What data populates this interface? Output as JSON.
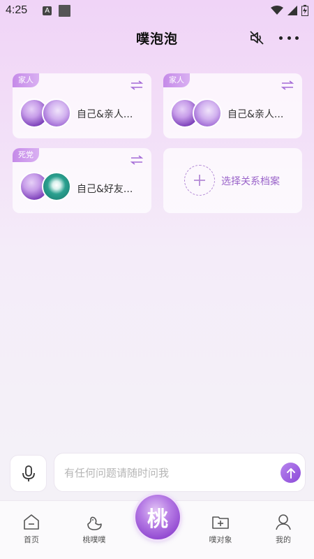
{
  "status_bar": {
    "time": "4:25",
    "a_badge": "A"
  },
  "header": {
    "title": "噗泡泡"
  },
  "cards": [
    {
      "tag": "家人",
      "label": "自己&亲人..."
    },
    {
      "tag": "家人",
      "label": "自己&亲人..."
    },
    {
      "tag": "死党",
      "label": "自己&好友..."
    }
  ],
  "add_card": {
    "label": "选择关系档案"
  },
  "chat": {
    "placeholder": "有任何问题请随时问我"
  },
  "center_button": {
    "label": "桃"
  },
  "tabs": [
    {
      "label": "首页"
    },
    {
      "label": "桃噗噗"
    },
    {
      "label": "噗对象"
    },
    {
      "label": "我的"
    }
  ],
  "colors": {
    "accent": "#9b57dc",
    "tag": "#c58ae8"
  }
}
